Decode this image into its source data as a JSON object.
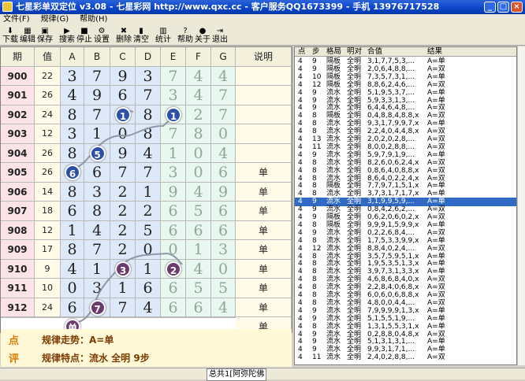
{
  "app": {
    "title": "七星彩单双定位 v3.08 - 七星彩网 http://www.qxc.cc - 客户服务QQ1673399 - 手机 13976717528",
    "minimize": "_",
    "maximize": "□",
    "close": "×"
  },
  "menu": [
    "文件(F)",
    "规律(G)",
    "帮助(H)"
  ],
  "toolbar": [
    {
      "label": "下载",
      "icon": "download-icon",
      "glyph": "⬇"
    },
    {
      "label": "编辑",
      "icon": "edit-icon",
      "glyph": "▦"
    },
    {
      "label": "保存",
      "icon": "save-icon",
      "glyph": "▣"
    },
    {
      "label": "搜索",
      "icon": "search-icon",
      "glyph": "▶"
    },
    {
      "label": "停止",
      "icon": "stop-icon",
      "glyph": "■"
    },
    {
      "label": "设置",
      "icon": "settings-icon",
      "glyph": "⚙"
    },
    {
      "label": "删除",
      "icon": "delete-icon",
      "glyph": "✖"
    },
    {
      "label": "清空",
      "icon": "clear-icon",
      "glyph": "▮"
    },
    {
      "label": "统计",
      "icon": "chart-icon",
      "glyph": "▥"
    },
    {
      "label": "帮助",
      "icon": "help-icon",
      "glyph": "?"
    },
    {
      "label": "关于",
      "icon": "about-icon",
      "glyph": "●"
    },
    {
      "label": "退出",
      "icon": "exit-icon",
      "glyph": "⇥"
    }
  ],
  "grid": {
    "headers": [
      "期",
      "值",
      "A",
      "B",
      "C",
      "D",
      "E",
      "F",
      "G",
      "说明"
    ],
    "rows": [
      {
        "period": "900",
        "value": "22",
        "digits": [
          "3",
          "7",
          "9",
          "3",
          "7",
          "4",
          "4"
        ],
        "note": ""
      },
      {
        "period": "901",
        "value": "26",
        "digits": [
          "4",
          "9",
          "6",
          "7",
          "3",
          "4",
          "7"
        ],
        "note": ""
      },
      {
        "period": "902",
        "value": "24",
        "digits": [
          "8",
          "7",
          "",
          "8",
          "",
          "2",
          "7"
        ],
        "note": ""
      },
      {
        "period": "903",
        "value": "12",
        "digits": [
          "3",
          "1",
          "0",
          "8",
          "7",
          "8",
          "0"
        ],
        "note": ""
      },
      {
        "period": "904",
        "value": "26",
        "digits": [
          "8",
          "",
          "9",
          "4",
          "1",
          "0",
          "4"
        ],
        "note": ""
      },
      {
        "period": "905",
        "value": "26",
        "digits": [
          "",
          "6",
          "7",
          "7",
          "3",
          "0",
          "6"
        ],
        "note": "单"
      },
      {
        "period": "906",
        "value": "14",
        "digits": [
          "8",
          "3",
          "2",
          "1",
          "9",
          "4",
          "9"
        ],
        "note": "单"
      },
      {
        "period": "907",
        "value": "18",
        "digits": [
          "6",
          "8",
          "2",
          "2",
          "6",
          "5",
          "6"
        ],
        "note": "单"
      },
      {
        "period": "908",
        "value": "12",
        "digits": [
          "1",
          "4",
          "2",
          "5",
          "6",
          "6",
          "6"
        ],
        "note": "单"
      },
      {
        "period": "909",
        "value": "17",
        "digits": [
          "8",
          "7",
          "2",
          "0",
          "0",
          "1",
          "3"
        ],
        "note": "单"
      },
      {
        "period": "910",
        "value": "9",
        "digits": [
          "4",
          "1",
          "",
          "1",
          "",
          "4",
          "0"
        ],
        "note": "单"
      },
      {
        "period": "911",
        "value": "10",
        "digits": [
          "0",
          "3",
          "1",
          "6",
          "6",
          "5",
          "5"
        ],
        "note": "单"
      },
      {
        "period": "912",
        "value": "24",
        "digits": [
          "6",
          "",
          "7",
          "4",
          "6",
          "6",
          "4"
        ],
        "note": "单"
      },
      {
        "period": "",
        "value": "",
        "digits": [
          "",
          "",
          "",
          "",
          "",
          "",
          ""
        ],
        "note": "单"
      }
    ],
    "markers": [
      {
        "label": "1",
        "row": 2,
        "col": 2,
        "style": "b"
      },
      {
        "label": "1",
        "row": 2,
        "col": 4,
        "style": "b"
      },
      {
        "label": "5",
        "row": 4,
        "col": 1,
        "style": "b"
      },
      {
        "label": "6",
        "row": 5,
        "col": 0,
        "style": "b"
      },
      {
        "label": "3",
        "row": 10,
        "col": 2,
        "style": "p"
      },
      {
        "label": "2",
        "row": 10,
        "col": 4,
        "style": "p"
      },
      {
        "label": "7",
        "row": 12,
        "col": 1,
        "style": "p"
      },
      {
        "label": "单",
        "row": 13,
        "col": 0,
        "style": "p"
      }
    ]
  },
  "rules": {
    "tag1": "点",
    "tag2": "评",
    "line1": "规律走势：A=单",
    "line2": "规律特点：流水 全明 9步"
  },
  "list": {
    "headers": [
      "点",
      "步",
      "格局",
      "明对",
      "合值",
      "结果"
    ],
    "rows": [
      [
        "4",
        "9",
        "隔板",
        "全明",
        "3,1,7,7,5,3,...",
        "A=单"
      ],
      [
        "4",
        "9",
        "隔板",
        "全明",
        "2,0,6,4,8,8,...",
        "A=双"
      ],
      [
        "4",
        "10",
        "隔板",
        "全明",
        "7,3,5,7,3,1,...",
        "A=单"
      ],
      [
        "4",
        "12",
        "隔板",
        "全明",
        "8,8,6,2,4,6,...",
        "A=双"
      ],
      [
        "4",
        "9",
        "流水",
        "全明",
        "5,1,9,5,3,7,...",
        "A=单"
      ],
      [
        "4",
        "9",
        "流水",
        "全明",
        "5,9,3,3,1,3,...",
        "A=单"
      ],
      [
        "4",
        "9",
        "流水",
        "全明",
        "6,4,4,6,4,8,...",
        "A=双"
      ],
      [
        "4",
        "8",
        "隔板",
        "全明",
        "0,4,8,8,4,8,8,x",
        "A=双"
      ],
      [
        "4",
        "8",
        "流水",
        "全明",
        "9,3,1,7,9,9,7,x",
        "A=单"
      ],
      [
        "4",
        "8",
        "流水",
        "全明",
        "2,2,4,0,4,4,8,x",
        "A=双"
      ],
      [
        "4",
        "13",
        "流水",
        "全明",
        "2,0,2,0,2,8,...",
        "A=双"
      ],
      [
        "4",
        "11",
        "流水",
        "全明",
        "8,0,0,2,8,8,...",
        "A=双"
      ],
      [
        "4",
        "9",
        "流水",
        "全明",
        "5,9,7,9,1,9,...",
        "A=单"
      ],
      [
        "4",
        "8",
        "流水",
        "全明",
        "8,2,6,0,6,2,4,x",
        "A=双"
      ],
      [
        "4",
        "8",
        "流水",
        "全明",
        "0,8,6,4,0,8,8,x",
        "A=双"
      ],
      [
        "4",
        "8",
        "流水",
        "全明",
        "8,6,4,0,2,2,4,x",
        "A=双"
      ],
      [
        "4",
        "8",
        "隔板",
        "全明",
        "7,7,9,7,1,5,1,x",
        "A=单"
      ],
      [
        "4",
        "8",
        "流水",
        "全明",
        "3,7,3,1,7,1,7,x",
        "A=单"
      ],
      [
        "4",
        "9",
        "流水",
        "全明",
        "3,1,9,9,5,9,...",
        "A=单"
      ],
      [
        "4",
        "9",
        "流水",
        "全明",
        "0,8,4,2,6,2,...",
        "A=双"
      ],
      [
        "4",
        "9",
        "隔板",
        "全明",
        "0,6,2,0,6,0,2,x",
        "A=双"
      ],
      [
        "4",
        "8",
        "隔板",
        "全明",
        "9,9,9,1,5,9,9,x",
        "A=单"
      ],
      [
        "4",
        "9",
        "流水",
        "全明",
        "0,2,2,6,8,4,...",
        "A=双"
      ],
      [
        "4",
        "8",
        "流水",
        "全明",
        "1,7,5,3,3,9,9,x",
        "A=单"
      ],
      [
        "4",
        "12",
        "流水",
        "全明",
        "8,8,4,0,2,4,...",
        "A=双"
      ],
      [
        "4",
        "8",
        "流水",
        "全明",
        "3,5,7,5,9,5,1,x",
        "A=单"
      ],
      [
        "4",
        "8",
        "流水",
        "全明",
        "1,9,5,3,5,1,3,x",
        "A=单"
      ],
      [
        "4",
        "8",
        "流水",
        "全明",
        "3,9,7,3,1,3,3,x",
        "A=单"
      ],
      [
        "4",
        "8",
        "流水",
        "全明",
        "4,6,8,6,8,4,0,x",
        "A=双"
      ],
      [
        "4",
        "8",
        "流水",
        "全明",
        "2,2,8,4,0,6,8,x",
        "A=双"
      ],
      [
        "4",
        "8",
        "流水",
        "全明",
        "6,0,6,0,6,8,8,x",
        "A=双"
      ],
      [
        "4",
        "8",
        "流水",
        "全明",
        "4,8,0,0,4,4,...",
        "A=双"
      ],
      [
        "4",
        "9",
        "流水",
        "全明",
        "7,9,9,9,9,1,3,x",
        "A=单"
      ],
      [
        "4",
        "9",
        "流水",
        "全明",
        "5,1,5,5,1,9,...",
        "A=单"
      ],
      [
        "4",
        "8",
        "流水",
        "全明",
        "1,3,1,5,5,3,1,x",
        "A=单"
      ],
      [
        "4",
        "9",
        "流水",
        "全明",
        "0,2,8,8,0,4,8,x",
        "A=双"
      ],
      [
        "4",
        "9",
        "流水",
        "全明",
        "5,1,3,1,3,1,...",
        "A=单"
      ],
      [
        "4",
        "9",
        "流水",
        "全明",
        "9,9,3,1,7,1,...",
        "A=单"
      ],
      [
        "4",
        "11",
        "流水",
        "全明",
        "2,4,0,2,8,8,...",
        "A=双"
      ]
    ],
    "selected_index": 18
  },
  "status": {
    "text": "总共1[阿弥陀佛"
  },
  "colors": {
    "title": "#0a44c8",
    "selection": "#316ac5",
    "rule_text": "#7a3a00",
    "rule_tag": "#d97a00",
    "bubble_blue": "#2c4fa8",
    "bubble_purple": "#6a3b6c"
  }
}
